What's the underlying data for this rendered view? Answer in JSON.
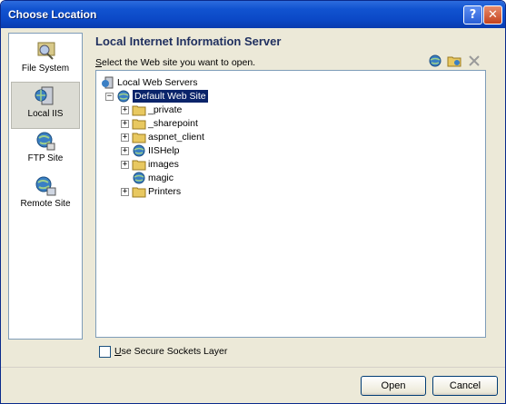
{
  "window": {
    "title": "Choose Location",
    "help_glyph": "?",
    "close_glyph": "✕"
  },
  "sidebar": {
    "items": [
      {
        "label": "File System",
        "icon": "folder-disk-icon",
        "selected": false
      },
      {
        "label": "Local IIS",
        "icon": "server-icon",
        "selected": true
      },
      {
        "label": "FTP Site",
        "icon": "ftp-globe-icon",
        "selected": false
      },
      {
        "label": "Remote Site",
        "icon": "remote-globe-icon",
        "selected": false
      }
    ]
  },
  "main": {
    "heading": "Local Internet Information Server",
    "instruction_prefix": "S",
    "instruction_rest": "elect the Web site you want to open.",
    "toolbar_icons": [
      "new-web-app-icon",
      "new-virtual-directory-icon",
      "delete-icon"
    ]
  },
  "tree": {
    "root": {
      "label": "Local Web Servers",
      "icon": "server-icon"
    },
    "site": {
      "label": "Default Web Site",
      "icon": "web-site-icon",
      "expander": "−",
      "selected": true
    },
    "children": [
      {
        "label": "_private",
        "icon": "folder-icon",
        "expander": "+"
      },
      {
        "label": "_sharepoint",
        "icon": "folder-icon",
        "expander": "+"
      },
      {
        "label": "aspnet_client",
        "icon": "folder-icon",
        "expander": "+"
      },
      {
        "label": "IISHelp",
        "icon": "globe-icon",
        "expander": "+"
      },
      {
        "label": "images",
        "icon": "folder-icon",
        "expander": "+"
      },
      {
        "label": "magic",
        "icon": "globe-icon",
        "expander": ""
      },
      {
        "label": "Printers",
        "icon": "folder-icon",
        "expander": "+"
      }
    ]
  },
  "footer": {
    "ssl_prefix": "U",
    "ssl_rest": "se Secure Sockets Layer",
    "ssl_checked": false,
    "open_label": "Open",
    "cancel_label": "Cancel"
  },
  "colors": {
    "title_bar": "#0b48c6",
    "selection": "#0a246a",
    "folder": "#e8c860",
    "globe": "#3a7fc4"
  }
}
